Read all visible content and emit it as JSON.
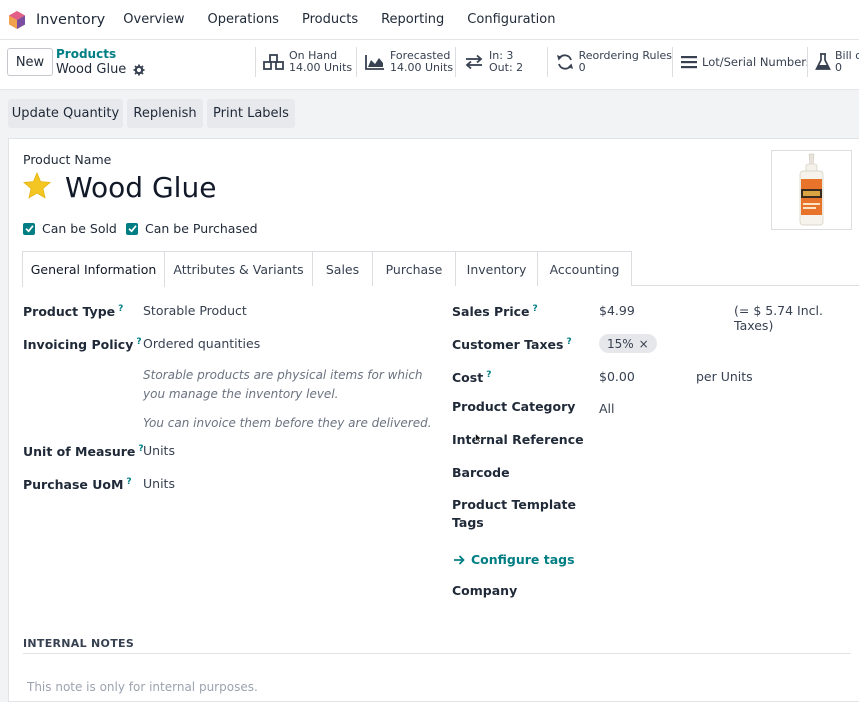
{
  "nav": {
    "app_name": "Inventory",
    "menu": [
      "Overview",
      "Operations",
      "Products",
      "Reporting",
      "Configuration"
    ]
  },
  "control": {
    "new_label": "New",
    "breadcrumb_parent": "Products",
    "breadcrumb_current": "Wood Glue"
  },
  "smart_buttons": {
    "on_hand": {
      "line1": "On Hand",
      "line2": "14.00 Units"
    },
    "forecasted": {
      "line1": "Forecasted",
      "line2": "14.00 Units"
    },
    "in_out": {
      "line1": "In: 3",
      "line2": "Out: 2"
    },
    "reordering": {
      "line1": "Reordering Rules",
      "line2": "0"
    },
    "lots": {
      "line1": "Lot/Serial Numbers"
    },
    "bom": {
      "line1": "Bill o",
      "line2": "0"
    }
  },
  "actions": [
    "Update Quantity",
    "Replenish",
    "Print Labels"
  ],
  "product": {
    "name_label": "Product Name",
    "name": "Wood Glue",
    "can_be_sold": "Can be Sold",
    "can_be_purchased": "Can be Purchased"
  },
  "tabs": [
    "General Information",
    "Attributes & Variants",
    "Sales",
    "Purchase",
    "Inventory",
    "Accounting"
  ],
  "general": {
    "product_type_label": "Product Type",
    "product_type": "Storable Product",
    "invoicing_policy_label": "Invoicing Policy",
    "invoicing_policy": "Ordered quantities",
    "help1_line1": "Storable products are physical items for which",
    "help1_line2": "you manage the inventory level.",
    "help2": "You can invoice them before they are delivered.",
    "uom_label": "Unit of Measure",
    "uom": "Units",
    "purchase_uom_label": "Purchase UoM",
    "purchase_uom": "Units",
    "sales_price_label": "Sales Price",
    "sales_price": "$4.99",
    "incl_taxes": "(= $ 5.74 Incl. Taxes)",
    "customer_taxes_label": "Customer Taxes",
    "tax_tag": "15%",
    "cost_label": "Cost",
    "cost": "$0.00",
    "cost_unit": "per Units",
    "category_label": "Product Category",
    "category": "All",
    "internal_ref_label": "Internal Reference",
    "barcode_label": "Barcode",
    "tags_label_line1": "Product Template",
    "tags_label_line2": "Tags",
    "configure_tags": "Configure tags",
    "company_label": "Company"
  },
  "notes": {
    "heading": "INTERNAL NOTES",
    "placeholder": "This note is only for internal purposes."
  }
}
